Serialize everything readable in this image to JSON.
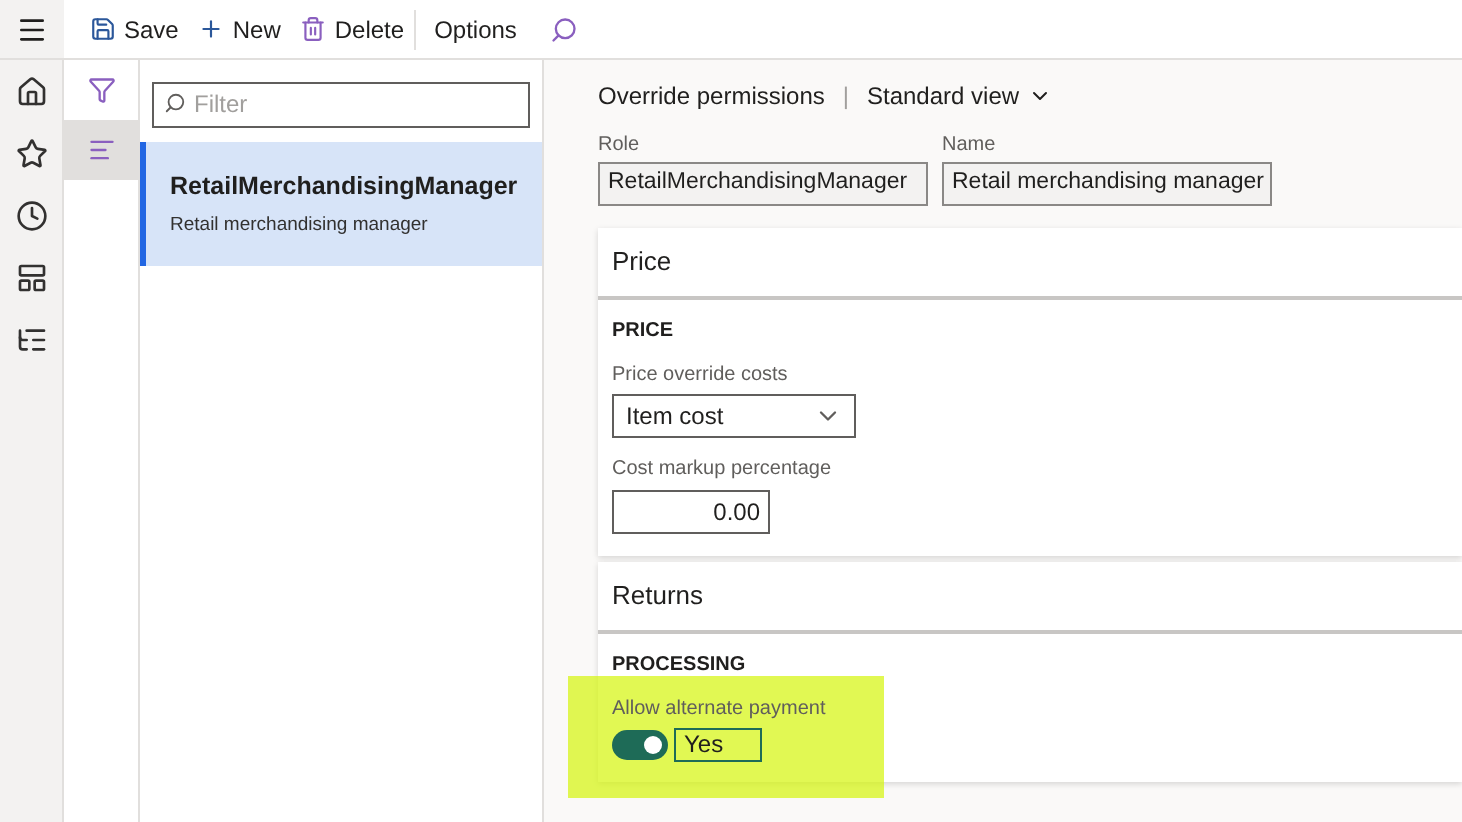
{
  "toolbar": {
    "buttons": [
      {
        "kind": "save",
        "label": "Save"
      },
      {
        "kind": "new",
        "label": "New"
      },
      {
        "kind": "delete",
        "label": "Delete"
      },
      {
        "kind": "plain",
        "label": "Options"
      }
    ]
  },
  "nav": {
    "items": [
      {
        "kind": "home",
        "selected": false
      },
      {
        "kind": "star",
        "selected": false
      },
      {
        "kind": "clock",
        "selected": false
      },
      {
        "kind": "workspace",
        "selected": false
      },
      {
        "kind": "list",
        "selected": false
      }
    ]
  },
  "filter_pane": {
    "items": [
      {
        "kind": "filter",
        "selected": false
      },
      {
        "kind": "list",
        "selected": true
      }
    ]
  },
  "list": {
    "filter_placeholder": "Filter",
    "items": [
      {
        "title": "RetailMerchandisingManager",
        "subtitle": "Retail merchandising manager",
        "selected": true
      }
    ]
  },
  "header": {
    "breadcrumb": "Override permissions",
    "separator": "|",
    "view": "Standard view"
  },
  "fields": [
    {
      "label": "Role",
      "value": "RetailMerchandisingManager"
    },
    {
      "label": "Name",
      "value": "Retail merchandising manager"
    }
  ],
  "sections": [
    {
      "title": "Price",
      "group": "PRICE",
      "controls": [
        {
          "kind": "dropdown",
          "label": "Price override costs",
          "value": "Item cost",
          "highlighted": false
        },
        {
          "kind": "number",
          "label": "Cost markup percentage",
          "value": "0.00",
          "highlighted": false
        }
      ]
    },
    {
      "title": "Returns",
      "group": "PROCESSING",
      "controls": [
        {
          "kind": "toggle",
          "label": "Allow alternate payment",
          "value": "Yes",
          "on": true,
          "highlighted": true
        }
      ]
    }
  ]
}
